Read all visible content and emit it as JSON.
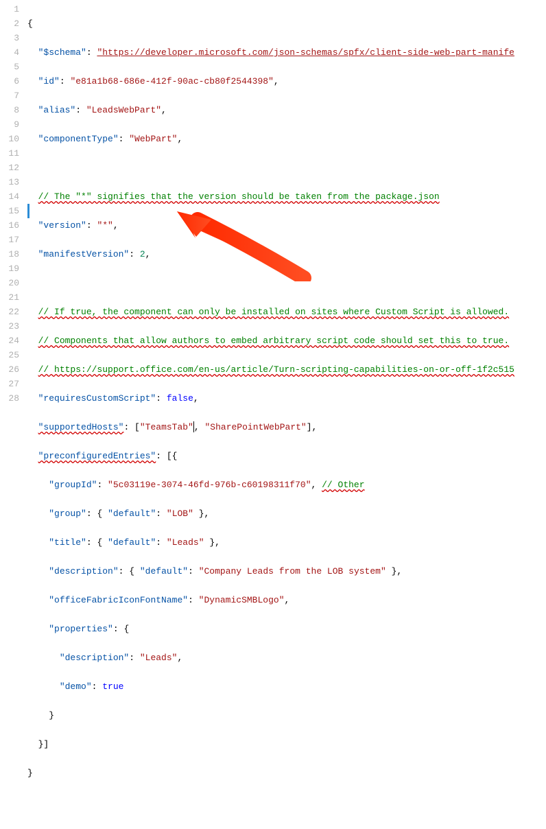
{
  "lines": {
    "l1": "1",
    "l2": "2",
    "l3": "3",
    "l4": "4",
    "l5": "5",
    "l6": "6",
    "l7": "7",
    "l8": "8",
    "l9": "9",
    "l10": "10",
    "l11": "11",
    "l12": "12",
    "l13": "13",
    "l14": "14",
    "l15": "15",
    "l16": "16",
    "l17": "17",
    "l18": "18",
    "l19": "19",
    "l20": "20",
    "l21": "21",
    "l22": "22",
    "l23": "23",
    "l24": "24",
    "l25": "25",
    "l26": "26",
    "l27": "27",
    "l28": "28"
  },
  "tokens": {
    "obrace": "{",
    "cbrace": "}",
    "obracket": "[",
    "cbracket": "]",
    "colon": ": ",
    "comma": ",",
    "space2": "  ",
    "space4": "    ",
    "space6": "      ",
    "k_schema": "\"$schema\"",
    "v_schema": "\"https://developer.microsoft.com/json-schemas/spfx/client-side-web-part-manife",
    "k_id": "\"id\"",
    "v_id": "\"e81a1b68-686e-412f-90ac-cb80f2544398\"",
    "k_alias": "\"alias\"",
    "v_alias": "\"LeadsWebPart\"",
    "k_componentType": "\"componentType\"",
    "v_componentType": "\"WebPart\"",
    "c1": "// The \"*\" signifies that the version should be taken from the package.json",
    "k_version": "\"version\"",
    "v_version": "\"*\"",
    "k_manifestVersion": "\"manifestVersion\"",
    "v_manifestVersion": "2",
    "c2": "// If true, the component can only be installed on sites where Custom Script is allowed.",
    "c3": "// Components that allow authors to embed arbitrary script code should set this to true.",
    "c4": "// https://support.office.com/en-us/article/Turn-scripting-capabilities-on-or-off-1f2c515",
    "k_requiresCustomScript": "\"requiresCustomScript\"",
    "v_false": "false",
    "k_supportedHosts": "\"supportedHosts\"",
    "v_teamsTab": "\"TeamsTab\"",
    "v_sharePoint": "\"SharePointWebPart\"",
    "k_preconfiguredEntries": "\"preconfiguredEntries\"",
    "k_groupId": "\"groupId\"",
    "v_groupId": "\"5c03119e-3074-46fd-976b-c60198311f70\"",
    "c_other": "// Other",
    "k_group": "\"group\"",
    "k_default": "\"default\"",
    "v_lob": "\"LOB\"",
    "k_title": "\"title\"",
    "v_leads": "\"Leads\"",
    "k_description": "\"description\"",
    "v_descCompany": "\"Company Leads from the LOB system\"",
    "k_officeFabric": "\"officeFabricIconFontName\"",
    "v_officeFabric": "\"DynamicSMBLogo\"",
    "k_properties": "\"properties\"",
    "k_desc2": "\"description\"",
    "v_desc2": "\"Leads\"",
    "k_demo": "\"demo\"",
    "v_true": "true"
  }
}
